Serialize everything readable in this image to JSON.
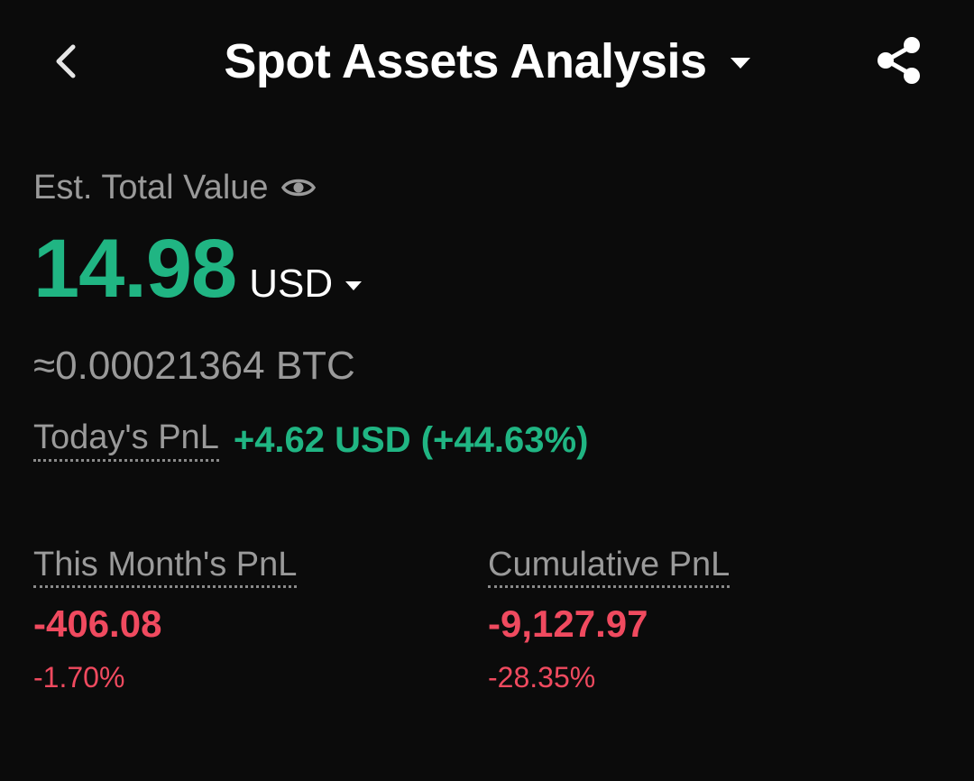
{
  "header": {
    "title": "Spot Assets Analysis",
    "back_icon": "chevron-left-icon",
    "dropdown_icon": "caret-down-icon",
    "share_icon": "share-icon"
  },
  "total": {
    "label": "Est. Total Value",
    "visibility_icon": "eye-icon",
    "value": "14.98",
    "currency": "USD",
    "btc_equivalent": "≈0.00021364 BTC"
  },
  "today": {
    "label": "Today's PnL",
    "value": "+4.62 USD (+44.63%)"
  },
  "month": {
    "label": "This Month's PnL",
    "value": "-406.08",
    "percent": "-1.70%"
  },
  "cumulative": {
    "label": "Cumulative PnL",
    "value": "-9,127.97",
    "percent": "-28.35%"
  },
  "colors": {
    "background": "#0b0b0b",
    "positive": "#20b583",
    "negative": "#f04a5f",
    "muted": "#9a9a9a"
  }
}
